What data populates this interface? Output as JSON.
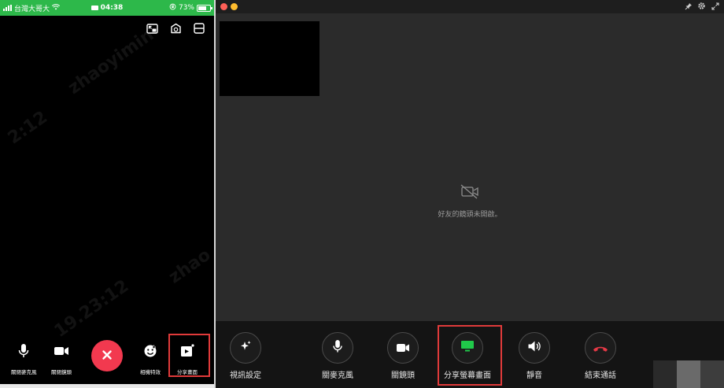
{
  "phone": {
    "status_bar": {
      "carrier": "台灣大哥大",
      "time": "04:38",
      "battery_text": "73%",
      "battery_level": 0.73,
      "background": "#2db84a"
    },
    "top_icons": [
      "picture-in-picture-icon",
      "flip-camera-icon",
      "layout-icon"
    ],
    "controls": {
      "mic_label": "關閉麥克風",
      "camera_label": "關閉鏡頭",
      "effects_label": "相機特效",
      "share_label": "分享畫面"
    },
    "end_call_color": "#f2394f",
    "watermarks": [
      "zhaoyimin",
      "2:12",
      "zhao",
      "19.23:12"
    ]
  },
  "desktop": {
    "camera_off_message": "好友的鏡頭未開啟。",
    "toolbar": {
      "video_settings_label": "視訊設定",
      "mic_label": "關麥克風",
      "camera_label": "關鏡頭",
      "share_label": "分享螢幕畫面",
      "speaker_label": "靜音",
      "end_call_label": "結束通話"
    },
    "colors": {
      "share_icon": "#20c94a",
      "end_call_icon": "#e63946",
      "highlight_box": "#e03a3a"
    }
  }
}
